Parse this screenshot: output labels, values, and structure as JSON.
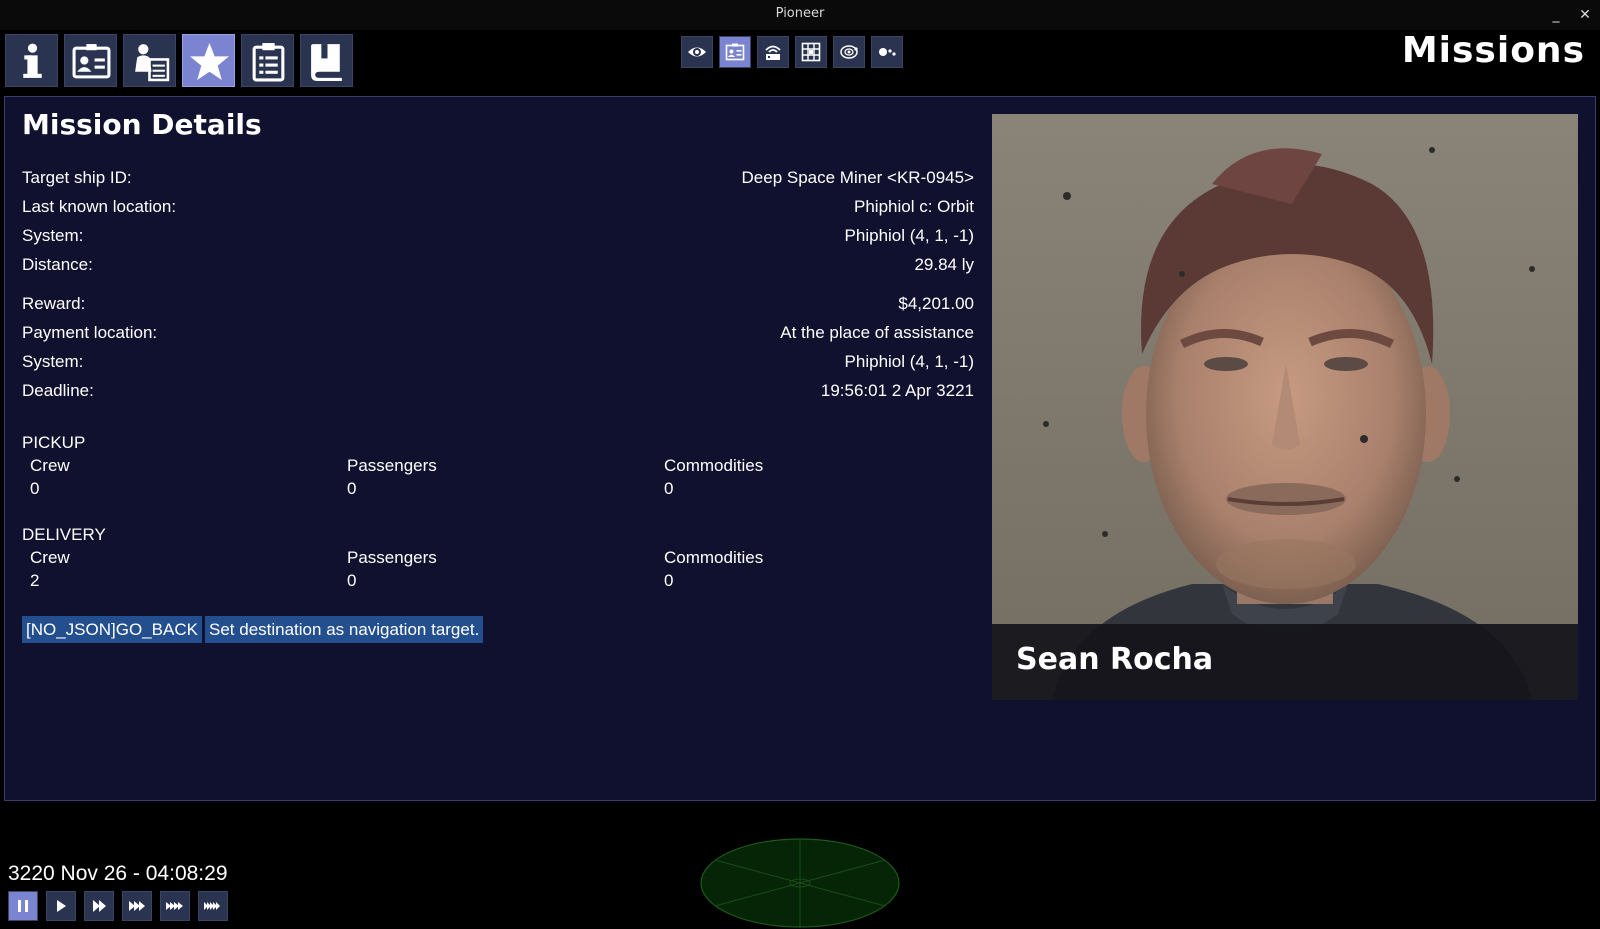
{
  "window": {
    "title": "Pioneer",
    "minimize": "_",
    "close": "✕"
  },
  "screen_title": "Missions",
  "tabs": [
    {
      "name": "info",
      "icon": "info-icon",
      "active": false
    },
    {
      "name": "personal",
      "icon": "id-card-icon",
      "active": false
    },
    {
      "name": "crew",
      "icon": "crew-roster-icon",
      "active": false
    },
    {
      "name": "reputation",
      "icon": "star-icon",
      "active": true
    },
    {
      "name": "missions",
      "icon": "clipboard-icon",
      "active": false
    },
    {
      "name": "journal",
      "icon": "book-icon",
      "active": false
    }
  ],
  "view_buttons": [
    {
      "icon": "eye-icon",
      "active": false
    },
    {
      "icon": "id-card-icon",
      "active": true
    },
    {
      "icon": "comms-icon",
      "active": false
    },
    {
      "icon": "sector-map-icon",
      "active": false
    },
    {
      "icon": "system-orbit-icon",
      "active": false
    },
    {
      "icon": "system-overview-icon",
      "active": false
    }
  ],
  "mission": {
    "heading": "Mission Details",
    "target_fields": [
      {
        "label": "Target ship ID:",
        "value": "Deep Space Miner <KR-0945>"
      },
      {
        "label": "Last known location:",
        "value": "Phiphiol c: Orbit"
      },
      {
        "label": "System:",
        "value": "Phiphiol (4, 1, -1)"
      },
      {
        "label": "Distance:",
        "value": "29.84 ly"
      }
    ],
    "reward_fields": [
      {
        "label": "Reward:",
        "value": "$4,201.00"
      },
      {
        "label": "Payment location:",
        "value": "At the place of assistance"
      },
      {
        "label": "System:",
        "value": "Phiphiol (4, 1, -1)"
      },
      {
        "label": "Deadline:",
        "value": "19:56:01 2 Apr 3221"
      }
    ],
    "pickup": {
      "title": "PICKUP",
      "columns": [
        "Crew",
        "Passengers",
        "Commodities"
      ],
      "values": [
        "0",
        "0",
        "0"
      ]
    },
    "delivery": {
      "title": "DELIVERY",
      "columns": [
        "Crew",
        "Passengers",
        "Commodities"
      ],
      "values": [
        "2",
        "0",
        "0"
      ]
    },
    "buttons": {
      "back": "[NO_JSON]GO_BACK",
      "set_nav": "Set destination as navigation target."
    }
  },
  "contact": {
    "name": "Sean Rocha",
    "portrait": "face-portrait"
  },
  "footer": {
    "game_time": "3220 Nov 26 - 04:08:29",
    "time_controls": [
      {
        "icon": "pause-icon",
        "active": true
      },
      {
        "icon": "play-icon",
        "active": false
      },
      {
        "icon": "fast-forward-1-icon",
        "active": false
      },
      {
        "icon": "fast-forward-2-icon",
        "active": false
      },
      {
        "icon": "fast-forward-3-icon",
        "active": false
      },
      {
        "icon": "fast-forward-4-icon",
        "active": false
      }
    ]
  }
}
